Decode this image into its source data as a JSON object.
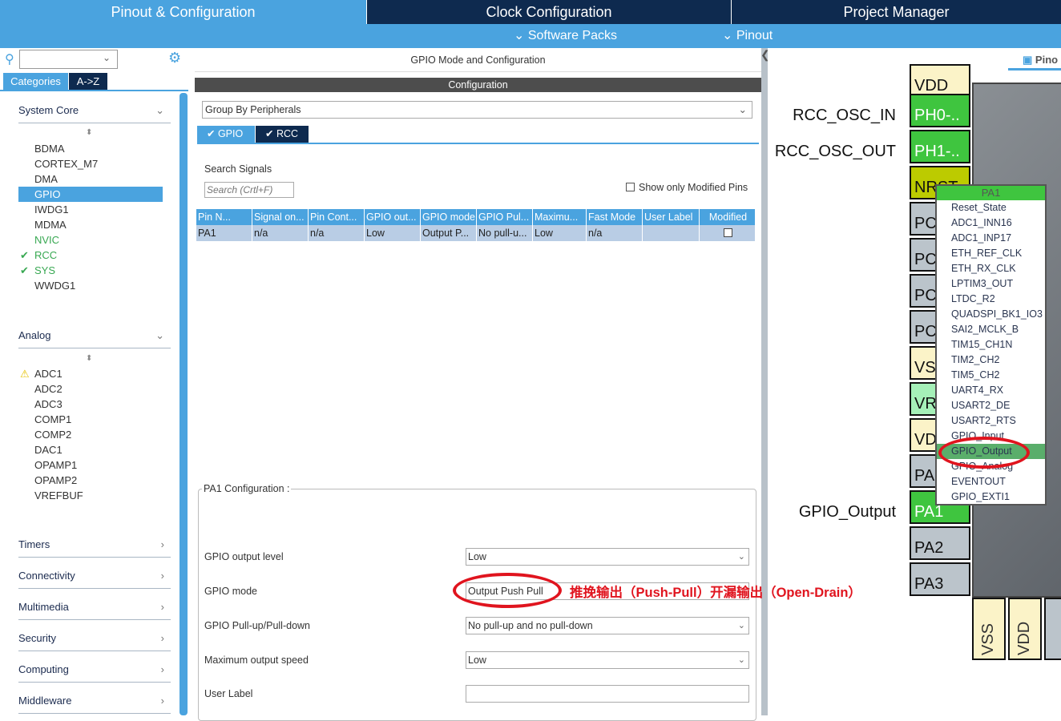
{
  "tabs": [
    {
      "label": "Pinout & Configuration",
      "active": true
    },
    {
      "label": "Clock Configuration"
    },
    {
      "label": "Project Manager"
    }
  ],
  "subbar": {
    "software_packs": "Software Packs",
    "pinout": "Pinout"
  },
  "left": {
    "search_value": "",
    "view_tabs": [
      "Categories",
      "A->Z"
    ],
    "categories": {
      "system_core": {
        "label": "System Core",
        "items": [
          {
            "label": "BDMA"
          },
          {
            "label": "CORTEX_M7"
          },
          {
            "label": "DMA"
          },
          {
            "label": "GPIO",
            "selected": true
          },
          {
            "label": "IWDG1"
          },
          {
            "label": "MDMA"
          },
          {
            "label": "NVIC",
            "status": "configured-green"
          },
          {
            "label": "RCC",
            "status": "ok"
          },
          {
            "label": "SYS",
            "status": "ok"
          },
          {
            "label": "WWDG1"
          }
        ]
      },
      "analog": {
        "label": "Analog",
        "items": [
          {
            "label": "ADC1",
            "status": "warning"
          },
          {
            "label": "ADC2"
          },
          {
            "label": "ADC3"
          },
          {
            "label": "COMP1"
          },
          {
            "label": "COMP2"
          },
          {
            "label": "DAC1"
          },
          {
            "label": "OPAMP1"
          },
          {
            "label": "OPAMP2"
          },
          {
            "label": "VREFBUF"
          }
        ]
      },
      "collapsed": [
        "Timers",
        "Connectivity",
        "Multimedia",
        "Security",
        "Computing",
        "Middleware"
      ]
    }
  },
  "mid": {
    "title": "GPIO Mode and Configuration",
    "config_header": "Configuration",
    "group_by": "Group By Peripherals",
    "sub_tabs": [
      "GPIO",
      "RCC"
    ],
    "search_label": "Search Signals",
    "search_placeholder": "Search (Crtl+F)",
    "show_modified": "Show only Modified Pins",
    "columns": [
      "Pin N...",
      "Signal on...",
      "Pin Cont...",
      "GPIO out...",
      "GPIO mode",
      "GPIO Pul...",
      "Maximu...",
      "Fast Mode",
      "User Label",
      "Modified"
    ],
    "rows": [
      [
        "PA1",
        "n/a",
        "n/a",
        "Low",
        "Output P...",
        "No pull-u...",
        "Low",
        "n/a",
        "",
        ""
      ]
    ],
    "pin_config_title": "PA1 Configuration :",
    "fields": [
      {
        "label": "GPIO output level",
        "value": "Low"
      },
      {
        "label": "GPIO mode",
        "value": "Output Push Pull"
      },
      {
        "label": "GPIO Pull-up/Pull-down",
        "value": "No pull-up and no pull-down"
      },
      {
        "label": "Maximum output speed",
        "value": "Low"
      },
      {
        "label": "User Label",
        "value": ""
      }
    ],
    "annotation": "推挽输出（Push-Pull）开漏输出（Open-Drain）"
  },
  "right": {
    "view_tab": "Pino",
    "pins": [
      "VDD",
      "PH0-..",
      "PH1-..",
      "NRST",
      "PC",
      "PC",
      "PC",
      "PC",
      "VS",
      "VR",
      "VD",
      "PA",
      "PA1",
      "PA2",
      "PA3"
    ],
    "bottom_pins": [
      "VSS",
      "VDD",
      ""
    ],
    "signal_labels": {
      "ph0": "RCC_OSC_IN",
      "ph1": "RCC_OSC_OUT",
      "pa1": "GPIO_Output"
    },
    "popup": {
      "title": "PA1",
      "items": [
        "Reset_State",
        "ADC1_INN16",
        "ADC1_INP17",
        "ETH_REF_CLK",
        "ETH_RX_CLK",
        "LPTIM3_OUT",
        "LTDC_R2",
        "QUADSPI_BK1_IO3",
        "SAI2_MCLK_B",
        "TIM15_CH1N",
        "TIM2_CH2",
        "TIM5_CH2",
        "UART4_RX",
        "USART2_DE",
        "USART2_RTS",
        "GPIO_Input",
        "GPIO_Output",
        "GPIO_Analog",
        "EVENTOUT",
        "GPIO_EXTI1"
      ],
      "selected": "GPIO_Output"
    }
  },
  "colors": {
    "accent": "#4aa3df",
    "navy": "#0e2a4f",
    "pin_green": "#3fc53f",
    "annotation_red": "#e0141e"
  }
}
